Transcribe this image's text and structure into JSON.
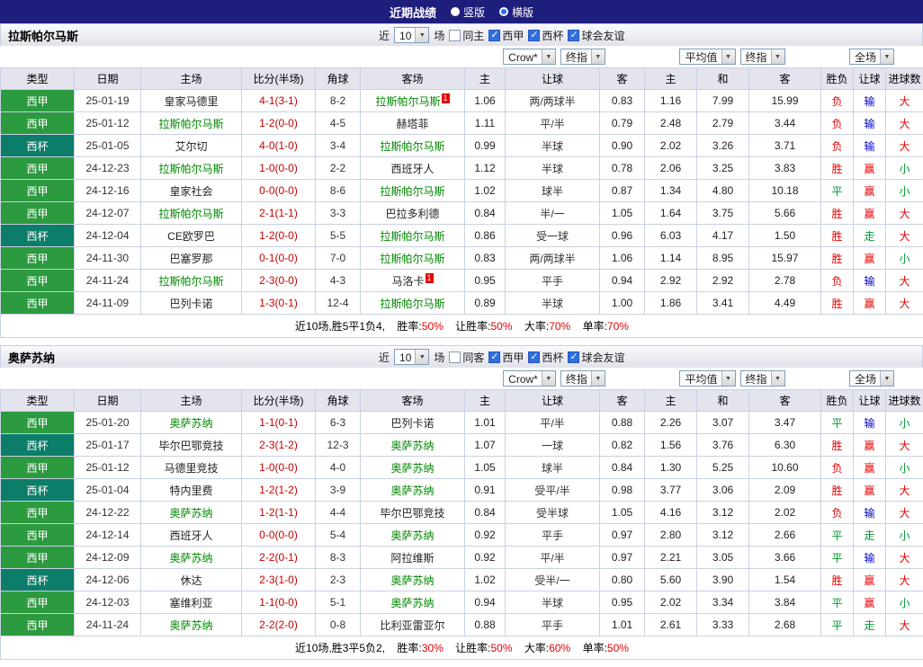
{
  "topbar": {
    "title": "近期战绩",
    "radios": [
      {
        "label": "竖版",
        "selected": false
      },
      {
        "label": "横版",
        "selected": true
      }
    ]
  },
  "filters": {
    "recent_label": "近",
    "recent_value": "10",
    "matches_label": "场"
  },
  "dropdowns": {
    "asian_source": "Crow*",
    "asian_time": "终指",
    "euro_source": "平均值",
    "euro_time": "终指",
    "scope": "全场"
  },
  "columns": [
    "类型",
    "日期",
    "主场",
    "比分(半场)",
    "角球",
    "客场",
    "主",
    "让球",
    "客",
    "主",
    "和",
    "客",
    "胜负",
    "让球",
    "进球数"
  ],
  "colors": {
    "topbar": "#1e1e7d",
    "liga_badge": "#2c9a3f",
    "cup_badge": "#0b7d68",
    "focal_team": "#008800",
    "score": "#c80000",
    "win": "#e60000",
    "draw": "#009933",
    "loss_handicap": "#0000cc"
  },
  "sections": [
    {
      "team": "拉斯帕尔马斯",
      "checks": [
        {
          "label": "同主",
          "checked": false
        },
        {
          "label": "西甲",
          "checked": true
        },
        {
          "label": "西杯",
          "checked": true
        },
        {
          "label": "球会友谊",
          "checked": true
        }
      ],
      "rows": [
        {
          "league": "西甲",
          "date": "25-01-19",
          "home": "皇家马德里",
          "home_focal": false,
          "home_red": "",
          "score": "4-1(3-1)",
          "corners": "8-2",
          "away": "拉斯帕尔马斯",
          "away_focal": true,
          "away_red": "1",
          "ah_home": "1.06",
          "handicap": "两/两球半",
          "ah_away": "0.83",
          "eu_home": "1.16",
          "eu_draw": "7.99",
          "eu_away": "15.99",
          "result": "负",
          "ah_result": "输",
          "goals": "大"
        },
        {
          "league": "西甲",
          "date": "25-01-12",
          "home": "拉斯帕尔马斯",
          "home_focal": true,
          "home_red": "",
          "score": "1-2(0-0)",
          "corners": "4-5",
          "away": "赫塔菲",
          "away_focal": false,
          "away_red": "",
          "ah_home": "1.11",
          "handicap": "平/半",
          "ah_away": "0.79",
          "eu_home": "2.48",
          "eu_draw": "2.79",
          "eu_away": "3.44",
          "result": "负",
          "ah_result": "输",
          "goals": "大"
        },
        {
          "league": "西杯",
          "date": "25-01-05",
          "home": "艾尔切",
          "home_focal": false,
          "home_red": "",
          "score": "4-0(1-0)",
          "corners": "3-4",
          "away": "拉斯帕尔马斯",
          "away_focal": true,
          "away_red": "",
          "ah_home": "0.99",
          "handicap": "半球",
          "ah_away": "0.90",
          "eu_home": "2.02",
          "eu_draw": "3.26",
          "eu_away": "3.71",
          "result": "负",
          "ah_result": "输",
          "goals": "大"
        },
        {
          "league": "西甲",
          "date": "24-12-23",
          "home": "拉斯帕尔马斯",
          "home_focal": true,
          "home_red": "",
          "score": "1-0(0-0)",
          "corners": "2-2",
          "away": "西班牙人",
          "away_focal": false,
          "away_red": "",
          "ah_home": "1.12",
          "handicap": "半球",
          "ah_away": "0.78",
          "eu_home": "2.06",
          "eu_draw": "3.25",
          "eu_away": "3.83",
          "result": "胜",
          "ah_result": "赢",
          "goals": "小"
        },
        {
          "league": "西甲",
          "date": "24-12-16",
          "home": "皇家社会",
          "home_focal": false,
          "home_red": "",
          "score": "0-0(0-0)",
          "corners": "8-6",
          "away": "拉斯帕尔马斯",
          "away_focal": true,
          "away_red": "",
          "ah_home": "1.02",
          "handicap": "球半",
          "ah_away": "0.87",
          "eu_home": "1.34",
          "eu_draw": "4.80",
          "eu_away": "10.18",
          "result": "平",
          "ah_result": "赢",
          "goals": "小"
        },
        {
          "league": "西甲",
          "date": "24-12-07",
          "home": "拉斯帕尔马斯",
          "home_focal": true,
          "home_red": "",
          "score": "2-1(1-1)",
          "corners": "3-3",
          "away": "巴拉多利德",
          "away_focal": false,
          "away_red": "",
          "ah_home": "0.84",
          "handicap": "半/一",
          "ah_away": "1.05",
          "eu_home": "1.64",
          "eu_draw": "3.75",
          "eu_away": "5.66",
          "result": "胜",
          "ah_result": "赢",
          "goals": "大"
        },
        {
          "league": "西杯",
          "date": "24-12-04",
          "home": "CE欧罗巴",
          "home_focal": false,
          "home_red": "",
          "score": "1-2(0-0)",
          "corners": "5-5",
          "away": "拉斯帕尔马斯",
          "away_focal": true,
          "away_red": "",
          "ah_home": "0.86",
          "handicap": "受一球",
          "ah_away": "0.96",
          "eu_home": "6.03",
          "eu_draw": "4.17",
          "eu_away": "1.50",
          "result": "胜",
          "ah_result": "走",
          "goals": "大"
        },
        {
          "league": "西甲",
          "date": "24-11-30",
          "home": "巴塞罗那",
          "home_focal": false,
          "home_red": "",
          "score": "0-1(0-0)",
          "corners": "7-0",
          "away": "拉斯帕尔马斯",
          "away_focal": true,
          "away_red": "",
          "ah_home": "0.83",
          "handicap": "两/两球半",
          "ah_away": "1.06",
          "eu_home": "1.14",
          "eu_draw": "8.95",
          "eu_away": "15.97",
          "result": "胜",
          "ah_result": "赢",
          "goals": "小"
        },
        {
          "league": "西甲",
          "date": "24-11-24",
          "home": "拉斯帕尔马斯",
          "home_focal": true,
          "home_red": "",
          "score": "2-3(0-0)",
          "corners": "4-3",
          "away": "马洛卡",
          "away_focal": false,
          "away_red": "1",
          "ah_home": "0.95",
          "handicap": "平手",
          "ah_away": "0.94",
          "eu_home": "2.92",
          "eu_draw": "2.92",
          "eu_away": "2.78",
          "result": "负",
          "ah_result": "输",
          "goals": "大"
        },
        {
          "league": "西甲",
          "date": "24-11-09",
          "home": "巴列卡诺",
          "home_focal": false,
          "home_red": "",
          "score": "1-3(0-1)",
          "corners": "12-4",
          "away": "拉斯帕尔马斯",
          "away_focal": true,
          "away_red": "",
          "ah_home": "0.89",
          "handicap": "半球",
          "ah_away": "1.00",
          "eu_home": "1.86",
          "eu_draw": "3.41",
          "eu_away": "4.49",
          "result": "胜",
          "ah_result": "赢",
          "goals": "大"
        }
      ],
      "summary": {
        "record": "近10场,胜5平1负4,",
        "stats": [
          {
            "label": "胜率:",
            "value": "50%"
          },
          {
            "label": "让胜率:",
            "value": "50%"
          },
          {
            "label": "大率:",
            "value": "70%"
          },
          {
            "label": "单率:",
            "value": "70%"
          }
        ]
      }
    },
    {
      "team": "奥萨苏纳",
      "checks": [
        {
          "label": "同客",
          "checked": false
        },
        {
          "label": "西甲",
          "checked": true
        },
        {
          "label": "西杯",
          "checked": true
        },
        {
          "label": "球会友谊",
          "checked": true
        }
      ],
      "rows": [
        {
          "league": "西甲",
          "date": "25-01-20",
          "home": "奥萨苏纳",
          "home_focal": true,
          "home_red": "",
          "score": "1-1(0-1)",
          "corners": "6-3",
          "away": "巴列卡诺",
          "away_focal": false,
          "away_red": "",
          "ah_home": "1.01",
          "handicap": "平/半",
          "ah_away": "0.88",
          "eu_home": "2.26",
          "eu_draw": "3.07",
          "eu_away": "3.47",
          "result": "平",
          "ah_result": "输",
          "goals": "小"
        },
        {
          "league": "西杯",
          "date": "25-01-17",
          "home": "毕尔巴鄂竞技",
          "home_focal": false,
          "home_red": "",
          "score": "2-3(1-2)",
          "corners": "12-3",
          "away": "奥萨苏纳",
          "away_focal": true,
          "away_red": "",
          "ah_home": "1.07",
          "handicap": "一球",
          "ah_away": "0.82",
          "eu_home": "1.56",
          "eu_draw": "3.76",
          "eu_away": "6.30",
          "result": "胜",
          "ah_result": "赢",
          "goals": "大"
        },
        {
          "league": "西甲",
          "date": "25-01-12",
          "home": "马德里竞技",
          "home_focal": false,
          "home_red": "",
          "score": "1-0(0-0)",
          "corners": "4-0",
          "away": "奥萨苏纳",
          "away_focal": true,
          "away_red": "",
          "ah_home": "1.05",
          "handicap": "球半",
          "ah_away": "0.84",
          "eu_home": "1.30",
          "eu_draw": "5.25",
          "eu_away": "10.60",
          "result": "负",
          "ah_result": "赢",
          "goals": "小"
        },
        {
          "league": "西杯",
          "date": "25-01-04",
          "home": "特内里费",
          "home_focal": false,
          "home_red": "",
          "score": "1-2(1-2)",
          "corners": "3-9",
          "away": "奥萨苏纳",
          "away_focal": true,
          "away_red": "",
          "ah_home": "0.91",
          "handicap": "受平/半",
          "ah_away": "0.98",
          "eu_home": "3.77",
          "eu_draw": "3.06",
          "eu_away": "2.09",
          "result": "胜",
          "ah_result": "赢",
          "goals": "大"
        },
        {
          "league": "西甲",
          "date": "24-12-22",
          "home": "奥萨苏纳",
          "home_focal": true,
          "home_red": "",
          "score": "1-2(1-1)",
          "corners": "4-4",
          "away": "毕尔巴鄂竞技",
          "away_focal": false,
          "away_red": "",
          "ah_home": "0.84",
          "handicap": "受半球",
          "ah_away": "1.05",
          "eu_home": "4.16",
          "eu_draw": "3.12",
          "eu_away": "2.02",
          "result": "负",
          "ah_result": "输",
          "goals": "大"
        },
        {
          "league": "西甲",
          "date": "24-12-14",
          "home": "西班牙人",
          "home_focal": false,
          "home_red": "",
          "score": "0-0(0-0)",
          "corners": "5-4",
          "away": "奥萨苏纳",
          "away_focal": true,
          "away_red": "",
          "ah_home": "0.92",
          "handicap": "平手",
          "ah_away": "0.97",
          "eu_home": "2.80",
          "eu_draw": "3.12",
          "eu_away": "2.66",
          "result": "平",
          "ah_result": "走",
          "goals": "小"
        },
        {
          "league": "西甲",
          "date": "24-12-09",
          "home": "奥萨苏纳",
          "home_focal": true,
          "home_red": "",
          "score": "2-2(0-1)",
          "corners": "8-3",
          "away": "阿拉维斯",
          "away_focal": false,
          "away_red": "",
          "ah_home": "0.92",
          "handicap": "平/半",
          "ah_away": "0.97",
          "eu_home": "2.21",
          "eu_draw": "3.05",
          "eu_away": "3.66",
          "result": "平",
          "ah_result": "输",
          "goals": "大"
        },
        {
          "league": "西杯",
          "date": "24-12-06",
          "home": "休达",
          "home_focal": false,
          "home_red": "",
          "score": "2-3(1-0)",
          "corners": "2-3",
          "away": "奥萨苏纳",
          "away_focal": true,
          "away_red": "",
          "ah_home": "1.02",
          "handicap": "受半/一",
          "ah_away": "0.80",
          "eu_home": "5.60",
          "eu_draw": "3.90",
          "eu_away": "1.54",
          "result": "胜",
          "ah_result": "赢",
          "goals": "大"
        },
        {
          "league": "西甲",
          "date": "24-12-03",
          "home": "塞维利亚",
          "home_focal": false,
          "home_red": "",
          "score": "1-1(0-0)",
          "corners": "5-1",
          "away": "奥萨苏纳",
          "away_focal": true,
          "away_red": "",
          "ah_home": "0.94",
          "handicap": "半球",
          "ah_away": "0.95",
          "eu_home": "2.02",
          "eu_draw": "3.34",
          "eu_away": "3.84",
          "result": "平",
          "ah_result": "赢",
          "goals": "小"
        },
        {
          "league": "西甲",
          "date": "24-11-24",
          "home": "奥萨苏纳",
          "home_focal": true,
          "home_red": "",
          "score": "2-2(2-0)",
          "corners": "0-8",
          "away": "比利亚雷亚尔",
          "away_focal": false,
          "away_red": "",
          "ah_home": "0.88",
          "handicap": "平手",
          "ah_away": "1.01",
          "eu_home": "2.61",
          "eu_draw": "3.33",
          "eu_away": "2.68",
          "result": "平",
          "ah_result": "走",
          "goals": "大"
        }
      ],
      "summary": {
        "record": "近10场,胜3平5负2,",
        "stats": [
          {
            "label": "胜率:",
            "value": "30%"
          },
          {
            "label": "让胜率:",
            "value": "50%"
          },
          {
            "label": "大率:",
            "value": "60%"
          },
          {
            "label": "单率:",
            "value": "50%"
          }
        ]
      }
    }
  ]
}
